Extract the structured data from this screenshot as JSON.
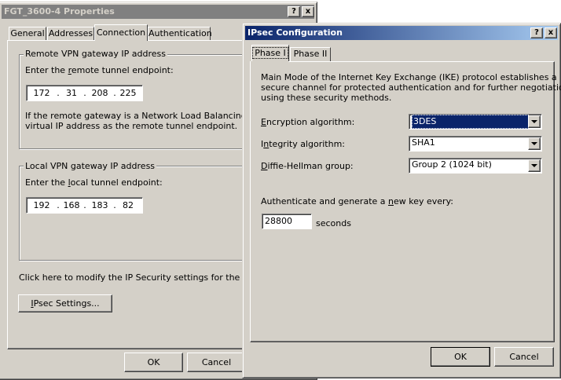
{
  "colors": {
    "desktop": "#ffffff",
    "face": "#d4d0c8",
    "active_title": "#0a246a",
    "inactive_title": "#808080"
  },
  "props": {
    "title": "FGT_3600-4 Properties",
    "help_btn": "?",
    "close_btn": "x",
    "tabs": [
      "General",
      "Addresses",
      "Connection",
      "Authentication"
    ],
    "remote_group": "Remote VPN gateway IP address",
    "remote_prompt_pre": "Enter the ",
    "remote_prompt_u": "r",
    "remote_prompt_post": "emote tunnel endpoint:",
    "remote_ip": [
      "172",
      "31",
      "208",
      "225"
    ],
    "remote_note_1": "If the remote gateway is a Network Load Balancing cluste",
    "remote_note_2": "virtual IP address as the remote tunnel endpoint.",
    "local_group": "Local VPN gateway IP address",
    "local_prompt_pre": "Enter the ",
    "local_prompt_u": "l",
    "local_prompt_post": "ocal tunnel endpoint:",
    "local_ip": [
      "192",
      "168",
      "183",
      "82"
    ],
    "ipsec_hint": "Click here to modify the IP Security settings for the tunnel:",
    "ipsec_btn_u": "I",
    "ipsec_btn_rest": "Psec Settings...",
    "ok": "OK",
    "cancel": "Cancel",
    "ip_dot": "."
  },
  "ipsec": {
    "title": "IPsec Configuration",
    "help_btn": "?",
    "close_btn": "x",
    "tabs": [
      "Phase I",
      "Phase II"
    ],
    "desc_1": "Main Mode of the Internet Key Exchange (IKE) protocol establishes a",
    "desc_2": "secure channel for protected authentication and for further negotiation",
    "desc_3": "using these security methods.",
    "enc_label_u": "E",
    "enc_label_rest": "ncryption algorithm:",
    "enc_value": "3DES",
    "int_label_pre": "I",
    "int_label_u": "n",
    "int_label_rest": "tegrity algorithm:",
    "int_value": "SHA1",
    "dh_label_u": "D",
    "dh_label_rest": "iffie-Hellman group:",
    "dh_value": "Group 2 (1024 bit)",
    "rekey_pre": "Authenticate and generate a ",
    "rekey_u": "n",
    "rekey_post": "ew key every:",
    "rekey_value": "28800",
    "seconds": "seconds",
    "ok": "OK",
    "cancel": "Cancel"
  }
}
